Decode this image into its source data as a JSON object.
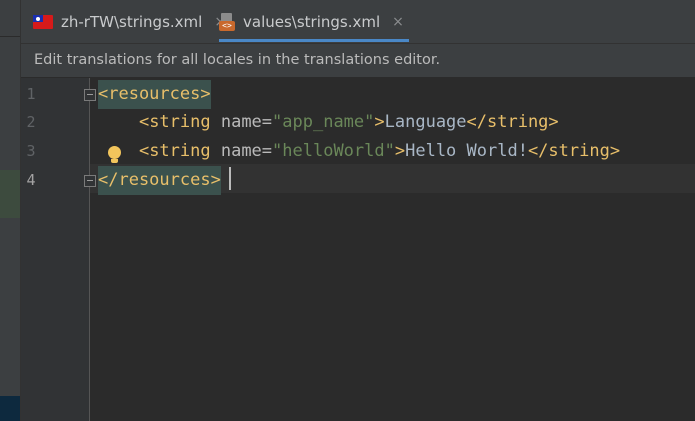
{
  "tabs": [
    {
      "label": "zh-rTW\\strings.xml",
      "icon": "taiwan-flag-icon",
      "close": "×"
    },
    {
      "label": "values\\strings.xml",
      "icon": "xml-file-icon",
      "close": "×",
      "active": true
    }
  ],
  "notice": {
    "text": "Edit translations for all locales in the translations editor."
  },
  "editor": {
    "line_numbers": [
      "1",
      "2",
      "3",
      "4"
    ],
    "active_line": 4,
    "lines": [
      {
        "tag_open": "<resources>"
      },
      {
        "indent": "    ",
        "tag_open": "<string",
        "attr": " name=",
        "value": "\"app_name\"",
        "close_bracket": ">",
        "text": "Language",
        "tag_close": "</string>"
      },
      {
        "indent": "    ",
        "tag_open": "<string",
        "attr": " name=",
        "value": "\"helloWorld\"",
        "close_bracket": ">",
        "text": "Hello World!",
        "tag_close": "</string>"
      },
      {
        "tag_close": "</resources>"
      }
    ]
  },
  "colors": {
    "tag": "#e8bf6a",
    "attribute": "#bababa",
    "string_value": "#6a8759",
    "text": "#a9b7c6",
    "tab_underline": "#4a88c7",
    "intention_bulb": "#f2c55c"
  }
}
